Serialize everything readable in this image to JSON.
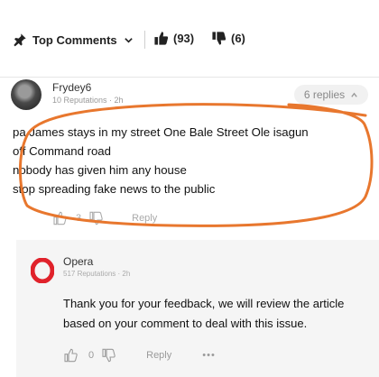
{
  "header": {
    "sort_label": "Top Comments",
    "upvotes": "(93)",
    "downvotes": "(6)"
  },
  "comment": {
    "username": "Frydey6",
    "meta": "10 Reputations · 2h",
    "replies": "6 replies",
    "lines": [
      "pa James stays in my street One Bale Street Ole isagun",
      "off Command road",
      "nobody has given him any house",
      "stop spreading fake news to the public"
    ],
    "like_count": "3",
    "reply_label": "Reply"
  },
  "reply": {
    "username": "Opera",
    "meta": "517 Reputations · 2h",
    "text": "Thank you for your feedback, we will review the article based on your comment to deal with this issue.",
    "like_count": "0",
    "reply_label": "Reply",
    "more": "•••"
  },
  "colors": {
    "highlight": "#e8772e",
    "opera_red": "#e0222b"
  }
}
